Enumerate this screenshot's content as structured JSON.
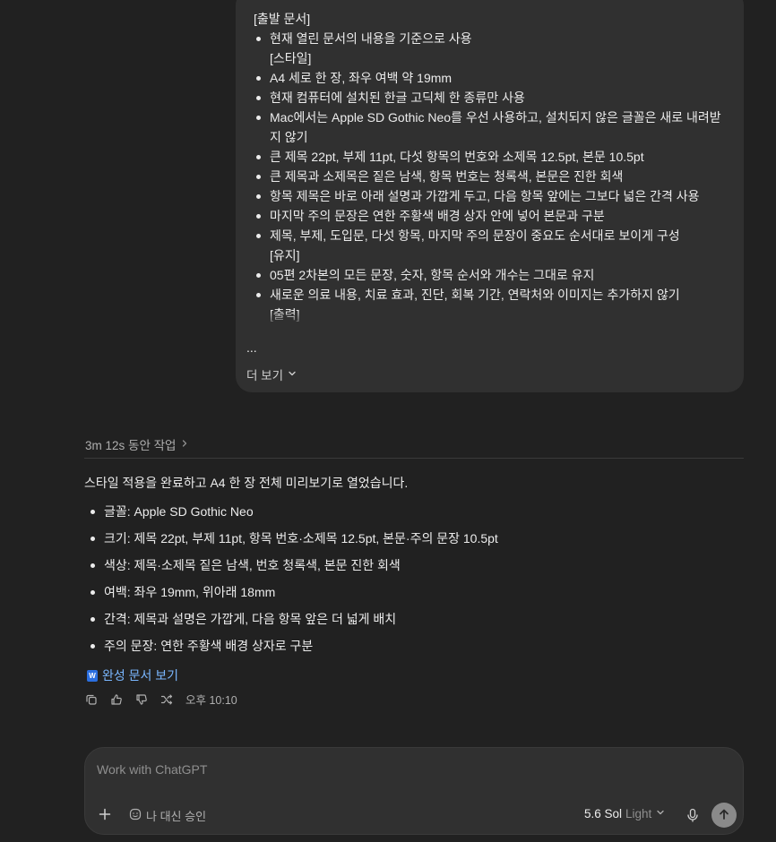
{
  "user_message": {
    "heading": "[출발 문서]",
    "items": [
      {
        "text": "현재 열린 문서의 내용을 기준으로 사용",
        "sub": "[스타일]"
      },
      {
        "text": "A4 세로 한 장, 좌우 여백 약 19mm"
      },
      {
        "text": "현재 컴퓨터에 설치된 한글 고딕체 한 종류만 사용"
      },
      {
        "text": "Mac에서는 Apple SD Gothic Neo를 우선 사용하고, 설치되지 않은 글꼴은 새로 내려받지 않기"
      },
      {
        "text": "큰 제목 22pt, 부제 11pt, 다섯 항목의 번호와 소제목 12.5pt, 본문 10.5pt"
      },
      {
        "text": "큰 제목과 소제목은 짙은 남색, 항목 번호는 청록색, 본문은 진한 회색"
      },
      {
        "text": "항목 제목은 바로 아래 설명과 가깝게 두고, 다음 항목 앞에는 그보다 넓은 간격 사용"
      },
      {
        "text": "마지막 주의 문장은 연한 주황색 배경 상자 안에 넣어 본문과 구분"
      },
      {
        "text": "제목, 부제, 도입문, 다섯 항목, 마지막 주의 문장이 중요도 순서대로 보이게 구성",
        "sub": "[유지]"
      },
      {
        "text": "05편 2차본의 모든 문장, 숫자, 항목 순서와 개수는 그대로 유지"
      },
      {
        "text": "새로운 의료 내용, 치료 효과, 진단, 회복 기간, 연락처와 이미지는 추가하지 않기",
        "sub": "[출력]"
      }
    ],
    "ellipsis": "...",
    "more_label": "더 보기"
  },
  "assistant": {
    "work_time": "3m 12s 동안 작업",
    "intro": "스타일 적용을 완료하고 A4 한 장 전체 미리보기로 열었습니다.",
    "summary": [
      "글꼴: Apple SD Gothic Neo",
      "크기: 제목 22pt, 부제 11pt, 항목 번호·소제목 12.5pt, 본문·주의 문장 10.5pt",
      "색상: 제목·소제목 짙은 남색, 번호 청록색, 본문 진한 회색",
      "여백: 좌우 19mm, 위아래 18mm",
      "간격: 제목과 설명은 가깝게, 다음 항목 앞은 더 넓게 배치",
      "주의 문장: 연한 주황색 배경 상자로 구분"
    ],
    "doc_link": "완성 문서 보기",
    "doc_icon_letter": "W",
    "timestamp": "오후 10:10"
  },
  "composer": {
    "placeholder": "Work with ChatGPT",
    "approve_label": "나 대신 승인",
    "model_name": "5.6 Sol",
    "model_mode": "Light"
  },
  "colors": {
    "background": "#212121",
    "bubble": "#303030",
    "link": "#7ab7ff",
    "doc_icon": "#2b6fe0"
  }
}
